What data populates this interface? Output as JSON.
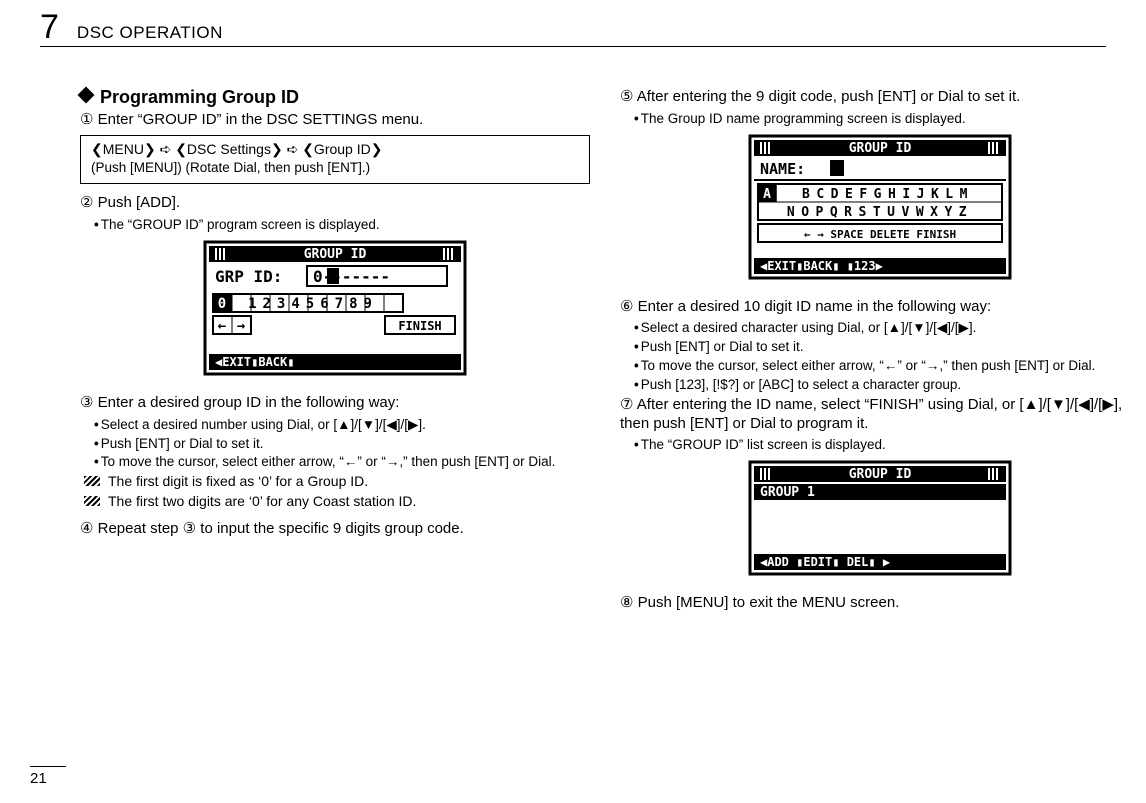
{
  "chapter": {
    "number": "7",
    "title": "DSC OPERATION"
  },
  "pageNumber": "21",
  "section": {
    "title": "Programming Group ID"
  },
  "menuBox": {
    "line1": "❮MENU❯   ➪   ❮DSC Settings❯   ➪   ❮Group ID❯",
    "line2": "(Push [MENU])       (Rotate Dial, then push [ENT].)"
  },
  "left": {
    "step1": "① Enter “GROUP ID” in the DSC SETTINGS menu.",
    "step2": "② Push [ADD].",
    "step2_bullet1": "The “GROUP ID” program screen is displayed.",
    "step3": "③ Enter a desired group ID in the following way:",
    "step3_b1": "Select a desired number using Dial, or [▲]/[▼]/[◀]/[▶].",
    "step3_b2": "Push [ENT] or Dial to set it.",
    "step3_b3": "To move the cursor, select either arrow, “←” or “→,” then push [ENT] or Dial.",
    "step3_note1": "The first digit is fixed as ‘0’ for a Group ID.",
    "step3_note2": "The first two digits are ‘0’ for any Coast station ID.",
    "step4": "④ Repeat step ③ to input the specific 9 digits group code."
  },
  "right": {
    "step5": "⑤ After entering the 9 digit code, push [ENT] or Dial to set it.",
    "step5_b1": "The Group ID name programming screen is displayed.",
    "step6": "⑥ Enter a desired 10 digit ID name in the following way:",
    "step6_b1": "Select a desired character using Dial, or [▲]/[▼]/[◀]/[▶].",
    "step6_b2": "Push [ENT] or Dial to set it.",
    "step6_b3": "To move the cursor, select either arrow, “←” or “→,” then push [ENT] or Dial.",
    "step6_b4": "Push [123], [!$?] or [ABC] to select a character group.",
    "step7": "⑦ After entering the ID name, select “FINISH” using Dial, or [▲]/[▼]/[◀]/[▶], then push [ENT] or Dial to program it.",
    "step7_b1": "The “GROUP ID” list screen is displayed.",
    "step8": "⑧ Push [MENU] to exit the MENU screen."
  },
  "lcd1": {
    "title": "GROUP ID",
    "fieldLabel": "GRP ID:",
    "fieldValue": "0-------",
    "digits": "0123456789",
    "arrows_row": "←  →",
    "finish": "FINISH",
    "softkeys": "◀EXIT▮BACK▮"
  },
  "lcd2": {
    "title": "GROUP ID",
    "nameLabel": "NAME:",
    "cursor": "■",
    "row1": "ABCDEFGHIJKLM",
    "row2": "NOPQRSTUVWXYZ",
    "row3": "←  →  SPACE DELETE FINISH",
    "softkeys": "◀EXIT▮BACK▮      ▮123▶"
  },
  "lcd3": {
    "title": "GROUP ID",
    "item1": "GROUP 1",
    "softkeys": "◀ADD ▮EDIT▮ DEL▮            ▶"
  }
}
